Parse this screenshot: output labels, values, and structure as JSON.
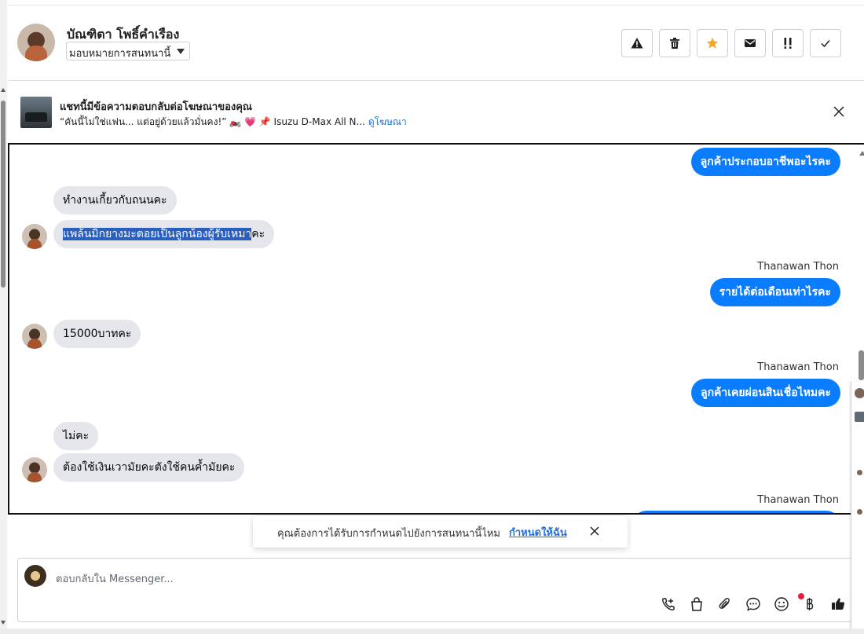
{
  "header": {
    "name": "บัณฑิตา โพธิ์คำเรือง",
    "assign_label": "มอบหมายการสนทนานี้",
    "actions": [
      "report-icon",
      "trash-icon",
      "star-icon",
      "mail-icon",
      "priority-icon",
      "check-icon"
    ],
    "accent": "#f6a623"
  },
  "ad": {
    "title": "แชทนี้มีข้อความตอบกลับต่อโฆษณาของคุณ",
    "snippet": "“คันนี้ไม่ใช่แฟน... แต่อยู่ด้วยแล้วมั่นคง!” 🏍️ 💗 📌 Isuzu D-Max All N...",
    "link": "ดูโฆษณา"
  },
  "messages": [
    {
      "dir": "out",
      "text": "ลูกค้าประกอบอาชีพอะไรคะ"
    },
    {
      "dir": "in",
      "text": "ทำงานเกี้ยวกับถนนคะ"
    },
    {
      "dir": "in",
      "text_selected": "แพล้นมิกยางมะตอยเป็นลูกน้องผู้รับเหมา",
      "text_rest": "คะ"
    },
    {
      "dir": "out",
      "sender": "Thanawan Thon",
      "text": "รายได้ต่อเดือนเท่าไรคะ"
    },
    {
      "dir": "in",
      "text": "15000บาทคะ"
    },
    {
      "dir": "out",
      "sender": "Thanawan Thon",
      "text": "ลูกค้าเคยผ่อนสินเชื่อไหมคะ"
    },
    {
      "dir": "in",
      "text": "ไม่คะ"
    },
    {
      "dir": "in",
      "text": "ต้องใช้เงินเวามัยคะตังใช้คนค้ำมัยคะ"
    },
    {
      "dir": "out",
      "sender": "Thanawan Thon",
      "text": ""
    }
  ],
  "toast": {
    "text": "คุณต้องการได้รับการกำหนดไปยังการสนทนานี้ไหม",
    "link": "กำหนดให้ฉัน"
  },
  "composer": {
    "placeholder": "ตอบกลับใน Messenger...",
    "tools": [
      "call-icon",
      "bag-icon",
      "attach-icon",
      "chat-icon",
      "emoji-icon",
      "baht-icon",
      "like-icon"
    ]
  },
  "colors": {
    "outgoing": "#0a7cff",
    "incoming": "#e4e6eb",
    "link": "#216fdb"
  }
}
